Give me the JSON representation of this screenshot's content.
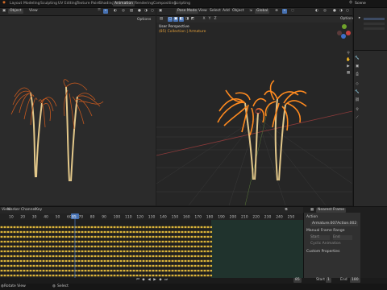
{
  "topbar": {
    "tabs": [
      "Layout",
      "Modeling",
      "Sculpting",
      "UV Editing",
      "Texture Paint",
      "Shading",
      "Animation",
      "Rendering",
      "Compositing",
      "Scripting"
    ],
    "active_tab": "Animation",
    "scene": "Scene"
  },
  "left_view": {
    "mode": "Object",
    "view": "View",
    "options": "Options"
  },
  "right_view": {
    "mode": "Pose Mode",
    "menus": [
      "View",
      "Select",
      "Add",
      "Object"
    ],
    "orientation": "Global",
    "title": "User Perspective",
    "subtitle": "(85) Collection | Armature",
    "options": "Options"
  },
  "timeline": {
    "menus": [
      "View",
      "Marker",
      "Channel",
      "Key"
    ],
    "frame_numbers": [
      "10",
      "20",
      "30",
      "40",
      "50",
      "60",
      "70",
      "80",
      "90",
      "100",
      "110",
      "120",
      "130",
      "140",
      "150",
      "160",
      "170",
      "180",
      "190",
      "200",
      "210",
      "220",
      "230",
      "240",
      "250"
    ],
    "current_frame": "85",
    "keying": "Nearest Frame"
  },
  "action_panel": {
    "header": "Action",
    "action_name": "Armature.007Action.002",
    "manual_frame_range": "Manual Frame Range",
    "start_label": "Start",
    "end_label": "End",
    "cyclic": "Cyclic Animation",
    "custom_props": "Custom Properties"
  },
  "playback": {
    "frame": "85",
    "start_label": "Start",
    "start": "1",
    "end_label": "End",
    "end": "180"
  },
  "status_bar": {
    "left": "Rotate View",
    "middle": "Select"
  },
  "colors": {
    "accent": "#4772b3",
    "selected_orange": "#ff8a1f",
    "keyframe": "#e0b83a",
    "bone": "#d9c079"
  }
}
